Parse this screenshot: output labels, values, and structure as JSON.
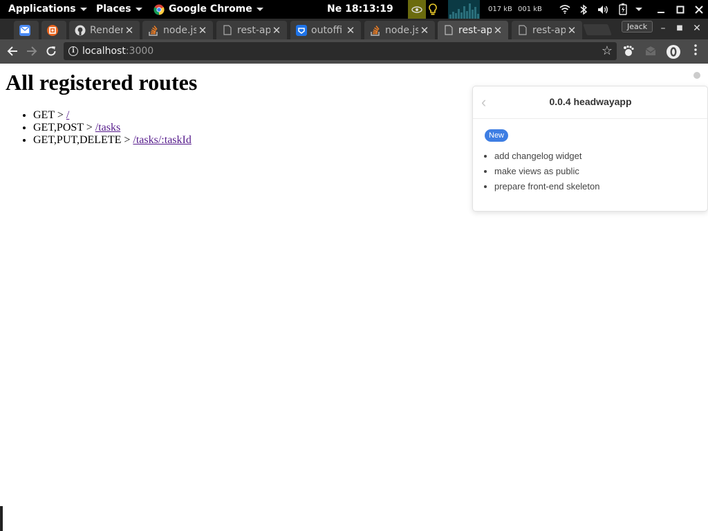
{
  "panel": {
    "applications": "Applications",
    "places": "Places",
    "app": "Google Chrome",
    "clock": "Ne 18:13:19",
    "net_down": "017 kB",
    "net_up": "001 kB"
  },
  "tabs": [
    {
      "title": "",
      "favicon": "gmail-icon",
      "active": false
    },
    {
      "title": "",
      "favicon": "html5-icon",
      "active": false
    },
    {
      "title": "Render",
      "favicon": "github-icon",
      "active": false
    },
    {
      "title": "node.js",
      "favicon": "stackoverflow-icon",
      "active": false
    },
    {
      "title": "rest-api",
      "favicon": "page-icon",
      "active": false
    },
    {
      "title": "outoffi",
      "favicon": "bootstrap-icon",
      "active": false
    },
    {
      "title": "node.js",
      "favicon": "stackoverflow-icon",
      "active": false
    },
    {
      "title": "rest-api",
      "favicon": "page-icon",
      "active": true
    },
    {
      "title": "rest-api",
      "favicon": "page-icon",
      "active": false
    }
  ],
  "profile": "Jeack",
  "omnibox": {
    "host": "localhost",
    "port": ":3000"
  },
  "page": {
    "heading": "All registered routes",
    "routes": [
      {
        "methods": "GET",
        "sep": " > ",
        "path": "/"
      },
      {
        "methods": "GET,POST",
        "sep": " > ",
        "path": "/tasks"
      },
      {
        "methods": "GET,PUT,DELETE",
        "sep": " > ",
        "path": "/tasks/:taskId"
      }
    ]
  },
  "widget": {
    "title": "0.0.4 headwayapp",
    "badge": "New",
    "items": [
      "add changelog widget",
      "make views as public",
      "prepare front-end skeleton"
    ],
    "badge_color": "#3e7ee3"
  }
}
